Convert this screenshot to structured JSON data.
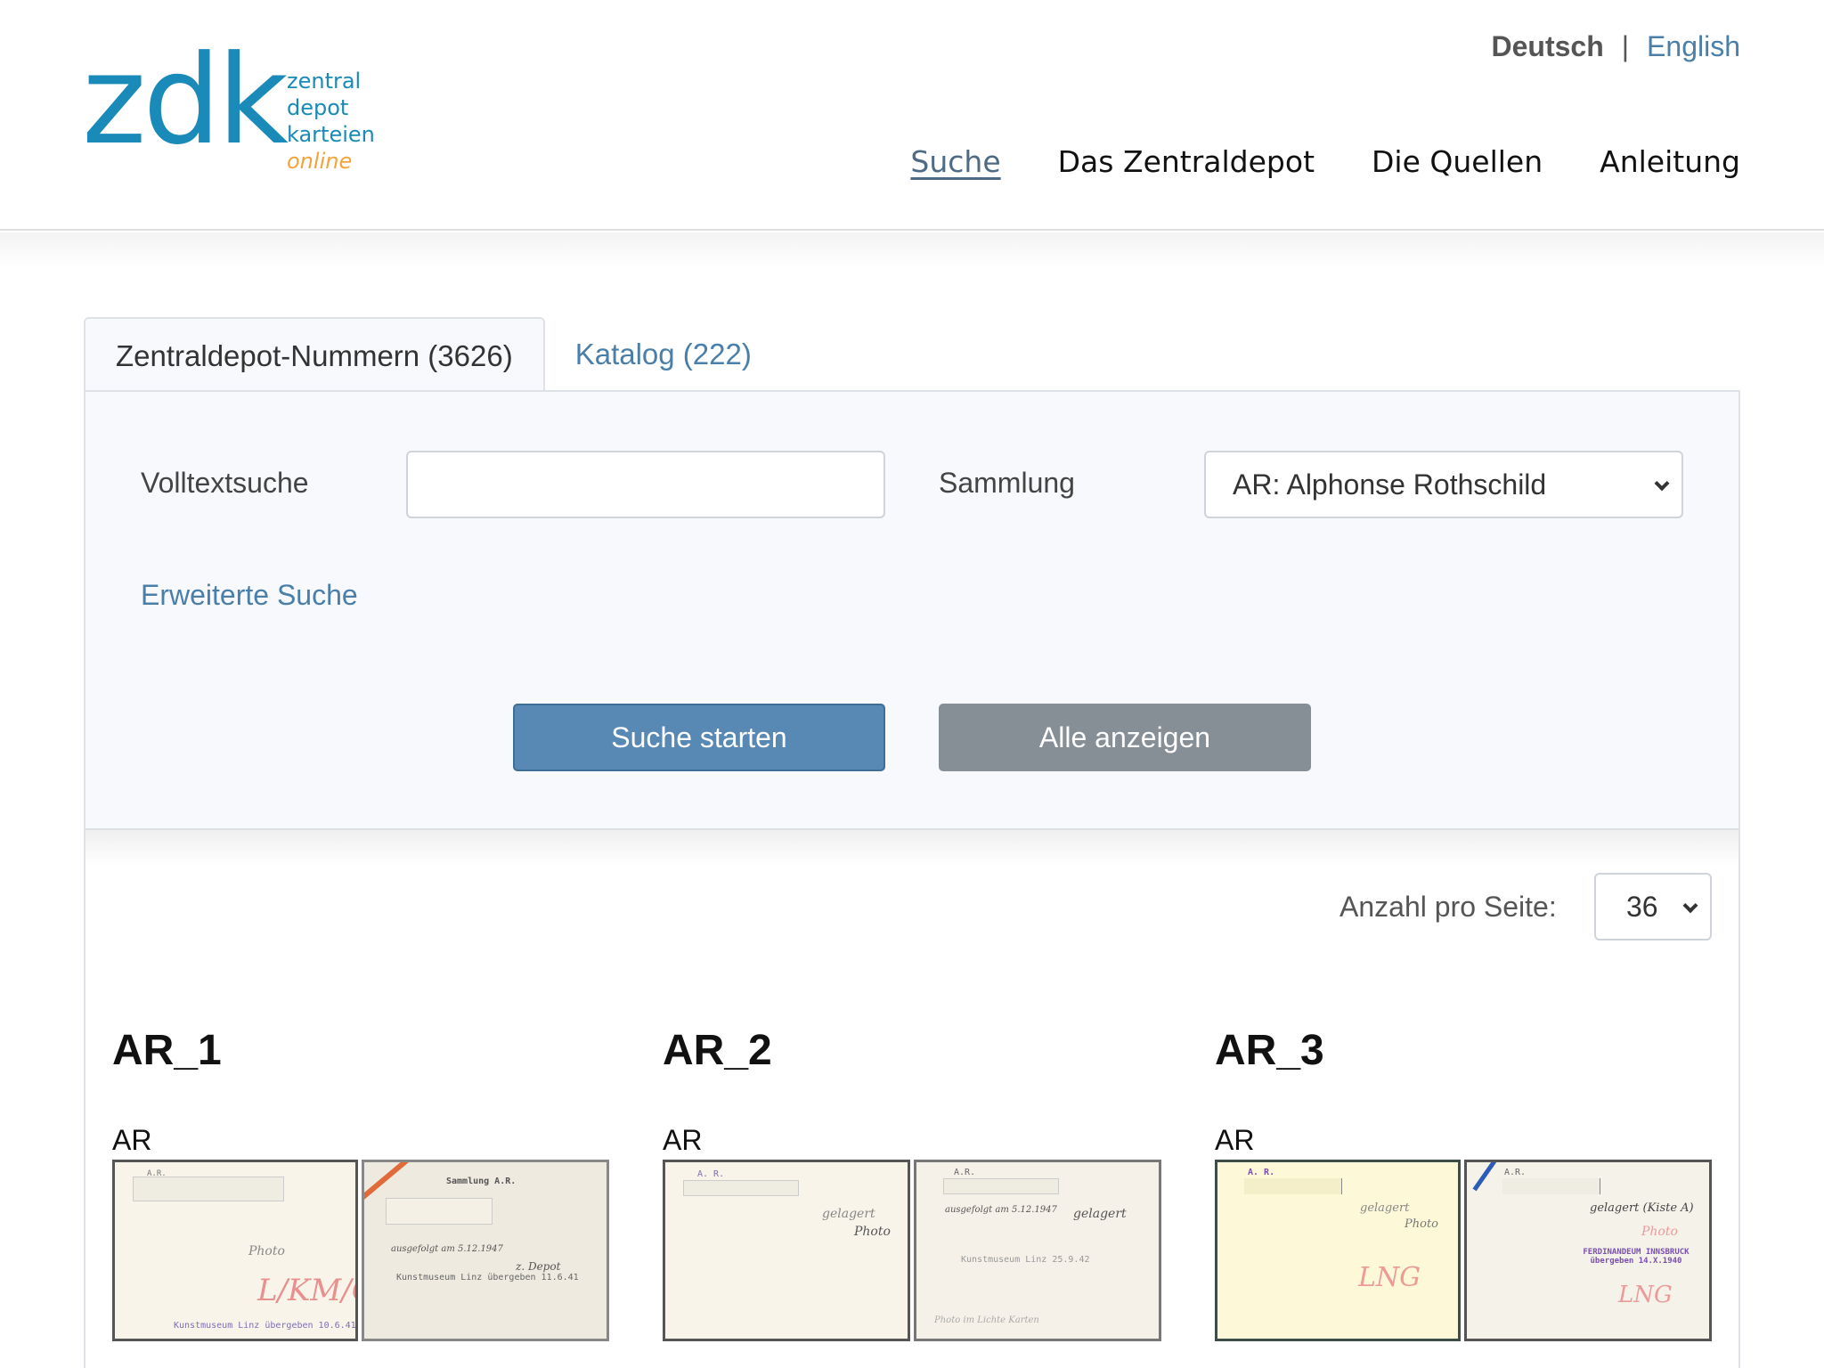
{
  "header": {
    "logo": {
      "mark": "zdk",
      "words": [
        "zentral",
        "depot",
        "karteien"
      ],
      "suffix": "online",
      "colors": {
        "primary": "#1a8ab8",
        "accent": "#f5a339"
      }
    },
    "languages": {
      "active": "Deutsch",
      "separator": "|",
      "other": "English"
    },
    "nav": [
      {
        "label": "Suche",
        "active": true
      },
      {
        "label": "Das Zentraldepot",
        "active": false
      },
      {
        "label": "Die Quellen",
        "active": false
      },
      {
        "label": "Anleitung",
        "active": false
      }
    ]
  },
  "tabs": [
    {
      "label": "Zentraldepot-Nummern (3626)",
      "active": true
    },
    {
      "label": "Katalog (222)",
      "active": false
    }
  ],
  "search": {
    "fulltext_label": "Volltextsuche",
    "fulltext_value": "",
    "collection_label": "Sammlung",
    "collection_selected": "AR: Alphonse Rothschild",
    "advanced_link": "Erweiterte Suche",
    "start_button": "Suche starten",
    "show_all_button": "Alle anzeigen"
  },
  "results": {
    "per_page_label": "Anzahl pro Seite:",
    "per_page_value": "36",
    "items": [
      {
        "title": "AR_1",
        "collection": "AR",
        "cards": [
          {
            "stamp": "Kunstmuseum Linz übergeben 10.6.41",
            "handwriting": [
              "Photo",
              "L/KM/GV"
            ]
          },
          {
            "heading": "Sammlung A.R.",
            "stamp": "Kunstmuseum Linz übergeben 11.6.41",
            "handwriting": [
              "ausgefolgt am 5.12.1947",
              "z. Depot"
            ]
          }
        ]
      },
      {
        "title": "AR_2",
        "collection": "AR",
        "cards": [
          {
            "heading": "A. R.",
            "handwriting": [
              "gelagert",
              "Photo"
            ]
          },
          {
            "heading": "A.R.",
            "stamp": "Kunstmuseum Linz 25.9.42",
            "handwriting": [
              "ausgefolgt am 5.12.1947",
              "gelagert",
              "Photo im Lichte Karten"
            ]
          }
        ]
      },
      {
        "title": "AR_3",
        "collection": "AR",
        "cards": [
          {
            "heading": "A. R.",
            "handwriting": [
              "gelagert",
              "Photo",
              "LNG"
            ]
          },
          {
            "heading": "A.R.",
            "stamp": "FERDINANDEUM INNSBRUCK übergeben 14.X.1940",
            "handwriting": [
              "gelagert (Kiste A)",
              "Photo",
              "LNG"
            ]
          }
        ]
      }
    ]
  }
}
